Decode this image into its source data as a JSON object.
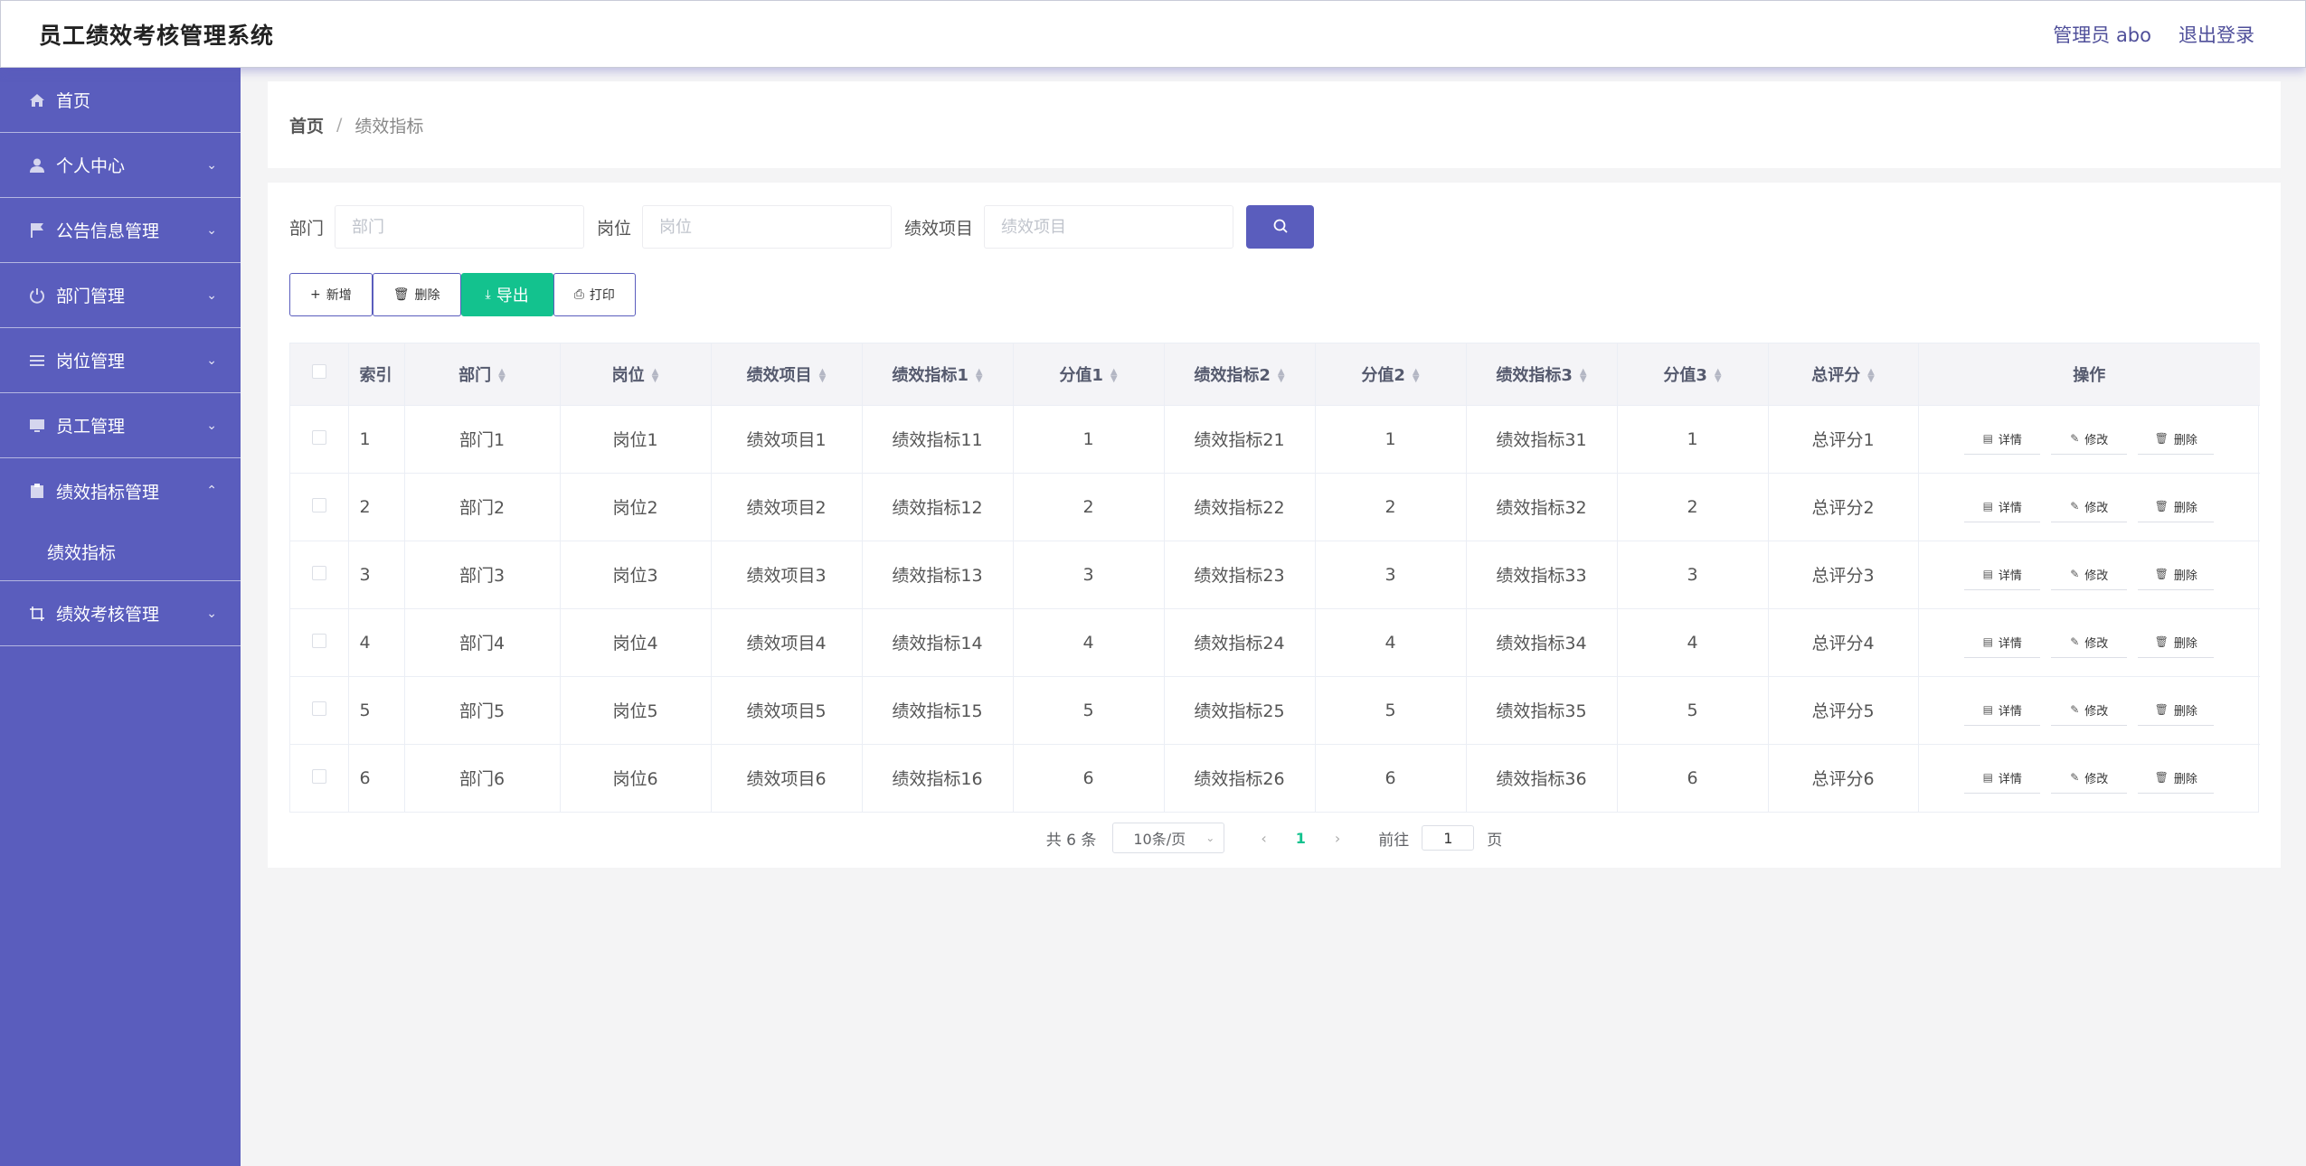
{
  "header": {
    "title": "员工绩效考核管理系统",
    "user_label": "管理员 abo",
    "logout_label": "退出登录"
  },
  "sidebar": {
    "items": [
      {
        "label": "首页",
        "icon": "home-icon"
      },
      {
        "label": "个人中心",
        "icon": "user-icon"
      },
      {
        "label": "公告信息管理",
        "icon": "flag-icon"
      },
      {
        "label": "部门管理",
        "icon": "power-icon"
      },
      {
        "label": "岗位管理",
        "icon": "list-icon"
      },
      {
        "label": "员工管理",
        "icon": "monitor-icon"
      },
      {
        "label": "绩效指标管理",
        "icon": "clipboard-icon"
      },
      {
        "label": "绩效考核管理",
        "icon": "crop-icon"
      }
    ],
    "sub_item": "绩效指标"
  },
  "breadcrumb": {
    "home": "首页",
    "sep": "/",
    "current": "绩效指标"
  },
  "search": {
    "dept_label": "部门",
    "dept_placeholder": "部门",
    "post_label": "岗位",
    "post_placeholder": "岗位",
    "project_label": "绩效项目",
    "project_placeholder": "绩效项目"
  },
  "actions": {
    "add": "新增",
    "delete": "删除",
    "export": "导出",
    "print": "打印"
  },
  "table": {
    "headers": [
      "索引",
      "部门",
      "岗位",
      "绩效项目",
      "绩效指标1",
      "分值1",
      "绩效指标2",
      "分值2",
      "绩效指标3",
      "分值3",
      "总评分",
      "操作"
    ],
    "ops": {
      "detail": "详情",
      "edit": "修改",
      "delete": "删除"
    },
    "rows": [
      [
        "1",
        "部门1",
        "岗位1",
        "绩效项目1",
        "绩效指标11",
        "1",
        "绩效指标21",
        "1",
        "绩效指标31",
        "1",
        "总评分1"
      ],
      [
        "2",
        "部门2",
        "岗位2",
        "绩效项目2",
        "绩效指标12",
        "2",
        "绩效指标22",
        "2",
        "绩效指标32",
        "2",
        "总评分2"
      ],
      [
        "3",
        "部门3",
        "岗位3",
        "绩效项目3",
        "绩效指标13",
        "3",
        "绩效指标23",
        "3",
        "绩效指标33",
        "3",
        "总评分3"
      ],
      [
        "4",
        "部门4",
        "岗位4",
        "绩效项目4",
        "绩效指标14",
        "4",
        "绩效指标24",
        "4",
        "绩效指标34",
        "4",
        "总评分4"
      ],
      [
        "5",
        "部门5",
        "岗位5",
        "绩效项目5",
        "绩效指标15",
        "5",
        "绩效指标25",
        "5",
        "绩效指标35",
        "5",
        "总评分5"
      ],
      [
        "6",
        "部门6",
        "岗位6",
        "绩效项目6",
        "绩效指标16",
        "6",
        "绩效指标26",
        "6",
        "绩效指标36",
        "6",
        "总评分6"
      ]
    ]
  },
  "pagination": {
    "total": "共 6 条",
    "page_size": "10条/页",
    "current_page": "1",
    "goto_label": "前往",
    "goto_value": "1",
    "page_suffix": "页"
  },
  "colors": {
    "brand": "#5a5dbd",
    "export_green": "#13c28e"
  }
}
